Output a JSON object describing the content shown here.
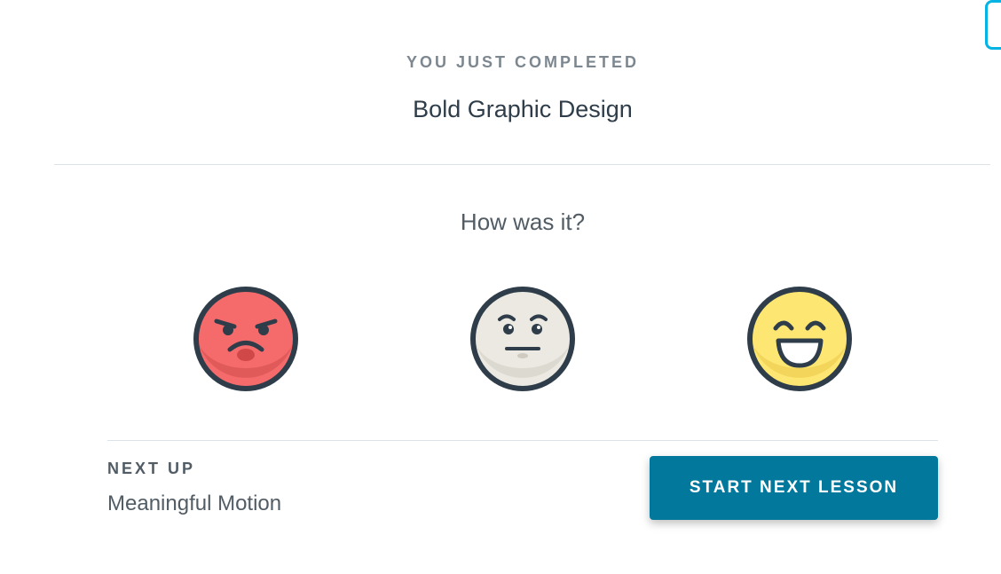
{
  "completion": {
    "label": "YOU JUST COMPLETED",
    "title": "Bold Graphic Design"
  },
  "rating": {
    "question": "How was it?",
    "options": [
      {
        "icon": "angry-face-icon",
        "color": "#f56b6b"
      },
      {
        "icon": "neutral-face-icon",
        "color": "#ebe9e2"
      },
      {
        "icon": "happy-face-icon",
        "color": "#fde772"
      }
    ]
  },
  "next": {
    "label": "NEXT UP",
    "title": "Meaningful Motion",
    "button_label": "START NEXT LESSON"
  },
  "colors": {
    "accent": "#02799c",
    "outline": "#2e3d49",
    "corner_accent": "#02b3e4"
  }
}
